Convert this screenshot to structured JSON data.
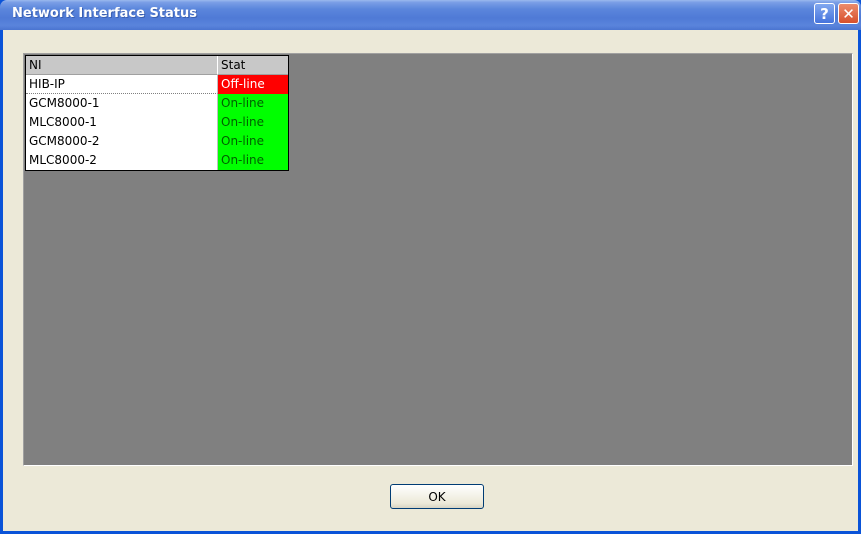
{
  "window": {
    "title": "Network Interface Status",
    "help_label": "?",
    "close_label": "✕"
  },
  "grid": {
    "columns": [
      "NI",
      "Stat"
    ],
    "rows": [
      {
        "ni": "HIB-IP",
        "stat": "Off-line",
        "status": "offline"
      },
      {
        "ni": "GCM8000-1",
        "stat": "On-line",
        "status": "online"
      },
      {
        "ni": "MLC8000-1",
        "stat": "On-line",
        "status": "online"
      },
      {
        "ni": "GCM8000-2",
        "stat": "On-line",
        "status": "online"
      },
      {
        "ni": "MLC8000-2",
        "stat": "On-line",
        "status": "online"
      }
    ]
  },
  "buttons": {
    "ok_label": "OK"
  },
  "colors": {
    "offline": "#ff0000",
    "online": "#00ff00",
    "panel": "#808080",
    "titlebar": "#5b86dc"
  }
}
